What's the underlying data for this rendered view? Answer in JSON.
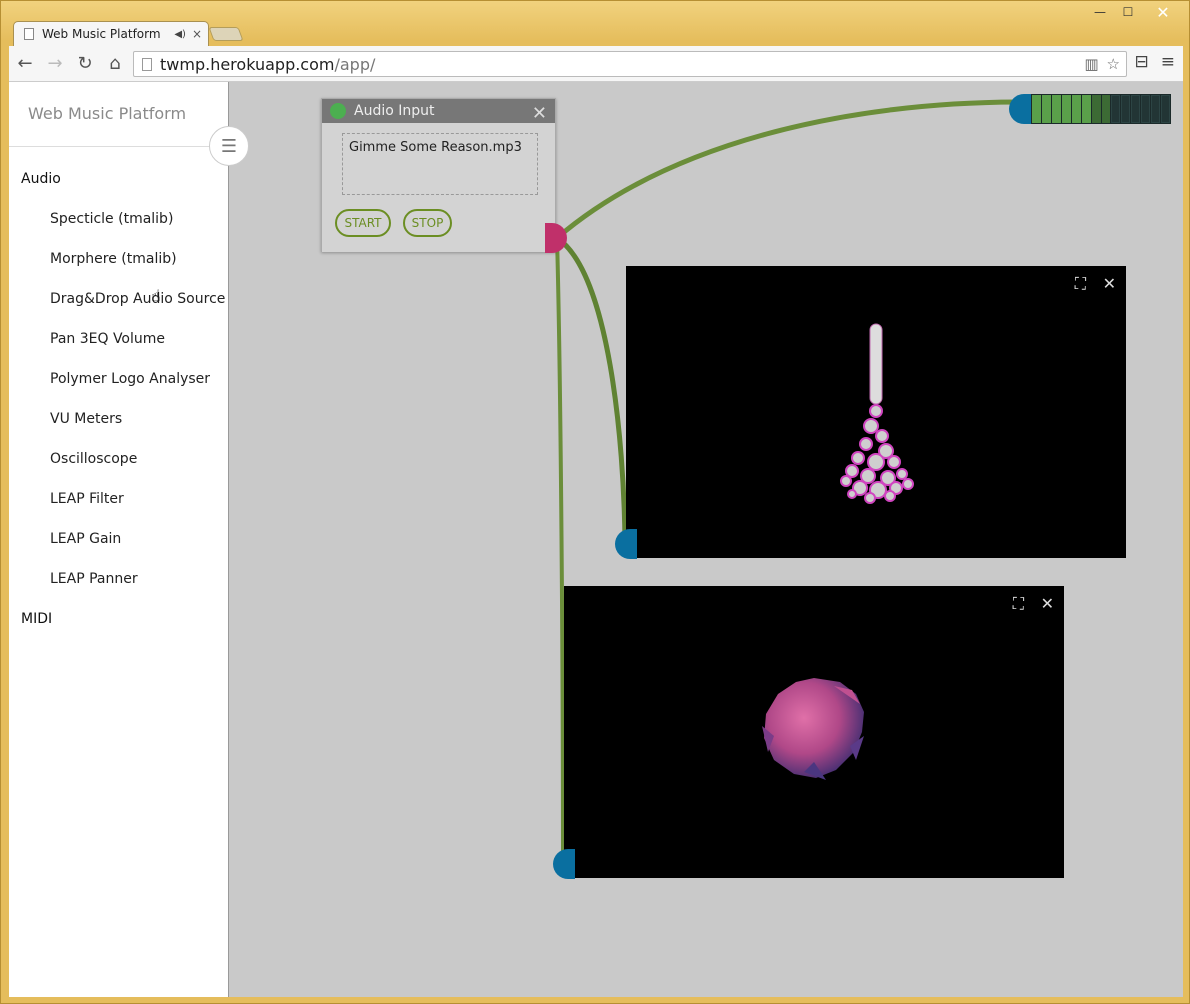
{
  "window": {
    "minimize_label": "—",
    "maximize_label": "☐",
    "close_label": "✕"
  },
  "tab": {
    "title": "Web Music Platform",
    "close_label": "×"
  },
  "toolbar": {
    "url_host": "twmp.herokuapp.com",
    "url_path": "/app/"
  },
  "sidebar": {
    "brand": "Web Music Platform",
    "section_audio": "Audio",
    "items": [
      {
        "label": "Specticle (tmalib)"
      },
      {
        "label": "Morphere (tmalib)"
      },
      {
        "label": "Drag&Drop Audio Source"
      },
      {
        "label": "Pan 3EQ Volume"
      },
      {
        "label": "Polymer Logo Analyser"
      },
      {
        "label": "VU Meters"
      },
      {
        "label": "Oscilloscope"
      },
      {
        "label": "LEAP Filter"
      },
      {
        "label": "LEAP Gain"
      },
      {
        "label": "LEAP Panner"
      }
    ],
    "section_midi": "MIDI"
  },
  "audio_input": {
    "title": "Audio Input",
    "file": "Gimme Some Reason.mp3",
    "start_label": "START",
    "stop_label": "STOP",
    "status_color": "#4caf50"
  },
  "colors": {
    "output_port": "#c0306a",
    "input_port": "#0a6fa0",
    "wire": "#6b8e3a",
    "vu_on": "#5aa04a"
  },
  "vu_meter": {
    "level": 0.55
  },
  "icons": {
    "expand": "expand-icon",
    "close": "close-icon",
    "menu": "hamburger-icon"
  }
}
